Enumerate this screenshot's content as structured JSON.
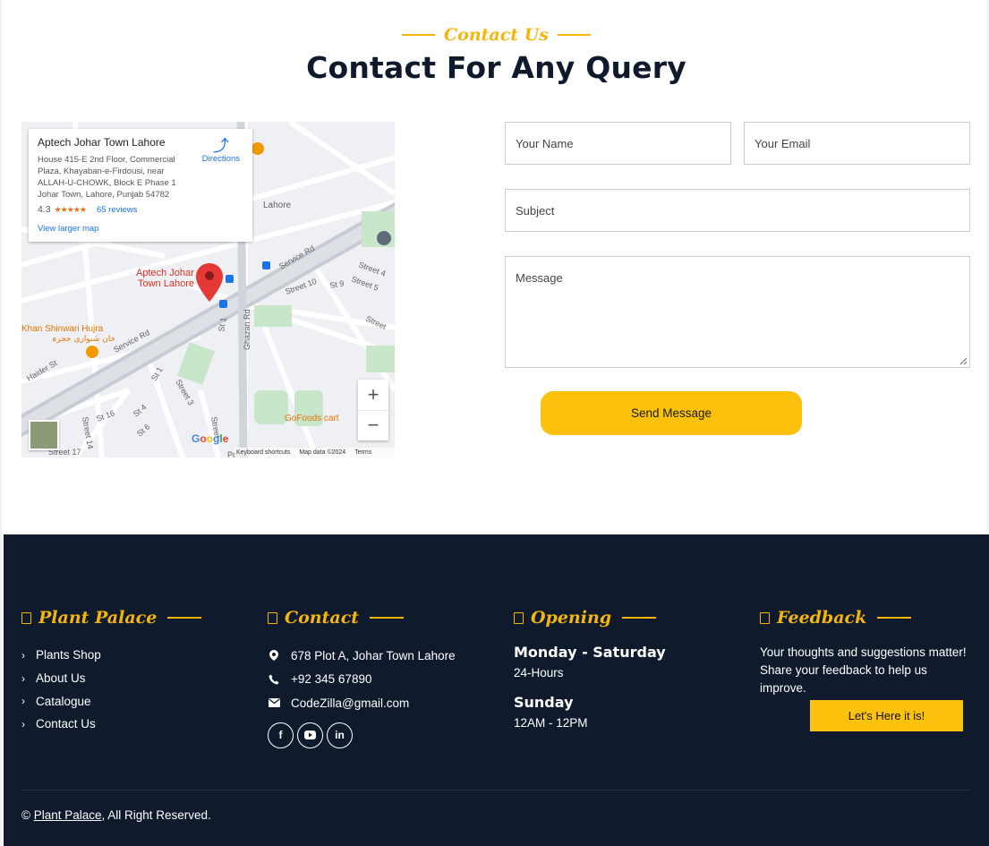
{
  "contact": {
    "tagline": "Contact Us",
    "title": "Contact For Any Query"
  },
  "map": {
    "place_name": "Aptech Johar Town Lahore",
    "address": "House 415-E 2nd Floor, Commercial Plaza, Khayaban-e-Firdousi, near ALLAH-U-CHOWK, Block E Phase 1 Johar Town, Lahore, Punjab 54782",
    "rating": "4.3",
    "stars": "★★★★★",
    "reviews": "65 reviews",
    "directions": "Directions",
    "larger_map": "View larger map",
    "marker_label": "Aptech Johar\nTown Lahore",
    "labels": [
      "Service Rd",
      "Service Rd",
      "Street 4",
      "Street 5",
      "Street 10",
      "St 9",
      "Street",
      "St 1",
      "Ghazan Rd",
      "Haider St",
      "St 1",
      "Street 3",
      "St 16",
      "St 4",
      "St 6",
      "Street 14",
      "Street",
      "Street 17",
      "Postal",
      "GoFoods cart",
      "Lahore",
      "Khan Shinwari Hujra",
      "خان شنواری حجرہ"
    ],
    "zoom_in": "+",
    "zoom_out": "−",
    "google": [
      "G",
      "o",
      "o",
      "g",
      "l",
      "e"
    ],
    "footer": [
      "Keyboard shortcuts",
      "Map data ©2024",
      "Terms"
    ]
  },
  "form": {
    "name_placeholder": "Your Name",
    "email_placeholder": "Your Email",
    "subject_placeholder": "Subject",
    "message_placeholder": "Message",
    "send_label": "Send Message"
  },
  "footer": {
    "brand": {
      "title": "Plant Palace",
      "links": [
        "Plants Shop",
        "About Us",
        "Catalogue",
        "Contact Us"
      ]
    },
    "contact": {
      "title": "Contact",
      "address": "678 Plot A, Johar Town Lahore",
      "phone": "+92 345 67890",
      "email": "CodeZilla@gmail.com",
      "socials": [
        "facebook-icon",
        "youtube-icon",
        "linkedin-icon"
      ]
    },
    "opening": {
      "title": "Opening",
      "day1": "Monday - Saturday",
      "hours1": "24-Hours",
      "day2": "Sunday",
      "hours2": "12AM - 12PM"
    },
    "feedback": {
      "title": "Feedback",
      "text": "Your thoughts and suggestions matter! Share your feedback to help us improve.",
      "button": "Let's Here it is!"
    },
    "copyright": {
      "prefix": "© ",
      "link": "Plant Palace",
      "suffix": ", All Right Reserved."
    }
  },
  "colors": {
    "accent": "#F5B60C",
    "button": "#FCC10C",
    "footer_bg": "#0f1a2c",
    "title": "#0f1a2c"
  }
}
